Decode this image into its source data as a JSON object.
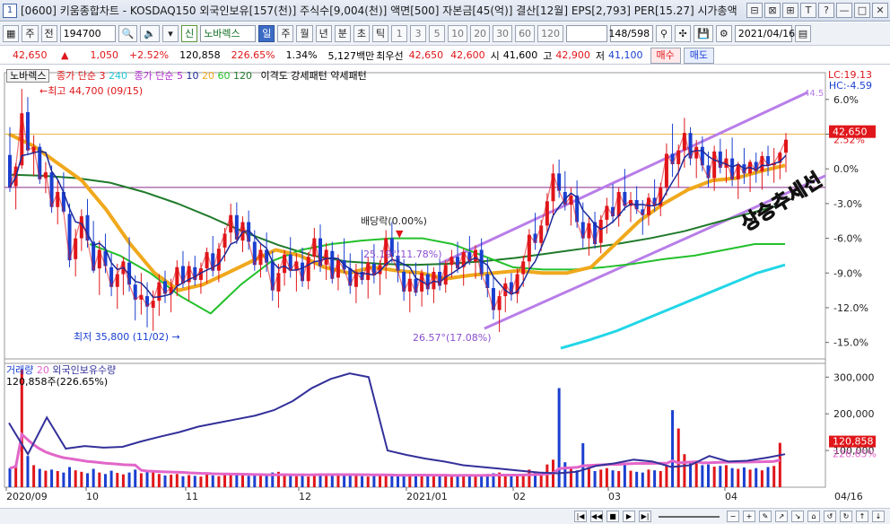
{
  "window": {
    "num": "1",
    "title": "[0600] 키움종합차트 - KOSDAQ150 외국인보유[157(천)] 주식수[9,004(천)] 액면[500] 자본금[45(억)] 결산[12월] EPS[2,793] PER[15.27] 시가총액",
    "buttons": [
      "⊟",
      "⊠",
      "⊞",
      "T",
      "?",
      "—",
      "□",
      "✕"
    ]
  },
  "toolbar": {
    "code_icon": "grid-icon",
    "stock_btn": "주",
    "jeon_btn": "전",
    "code_value": "194700",
    "signal_badge": "신",
    "stock_name": "노바렉스",
    "periods": [
      "일",
      "주",
      "월",
      "년",
      "분",
      "초",
      "틱"
    ],
    "active_period": "일",
    "ticks": [
      "1",
      "3",
      "5",
      "10",
      "20",
      "30",
      "60",
      "120"
    ],
    "count": "148",
    "total": "/598",
    "date": "2021/04/16"
  },
  "price": {
    "current": "42,650",
    "arrow": "▲",
    "change": "1,050",
    "change_pct": "+2.52%",
    "volume": "120,858",
    "vol_ratio": "226.65%",
    "turnover": "1.34%",
    "amount": "5,127백만",
    "best_ask_label": "최우선",
    "best_ask": "42,650",
    "best_bid": "42,600",
    "open_label": "시",
    "open": "41,600",
    "high_label": "고",
    "high": "42,900",
    "low_label": "저",
    "low": "41,100",
    "buy_btn": "매수",
    "sell_btn": "매도"
  },
  "legend": {
    "name": "노바렉스",
    "ma_label": "종가 단순",
    "ma1": "3",
    "ma2": "240",
    "ma_label2": "종가 단순",
    "ma3": "5",
    "ma4": "10",
    "ma5": "20",
    "ma6": "60",
    "ma7": "120",
    "extra": "이격도 강세패턴  약세패턴",
    "lc": "LC:19.13",
    "hc": "HC:-4.59"
  },
  "annotations": {
    "high_marker": "최고 44,700 (09/15)",
    "low_marker": "최저 35,800 (11/02)",
    "dividend": "배당락(0.00%)",
    "angle1": "25.19°(11.78%)",
    "angle2": "26.57°(17.08%)",
    "channel_top": "44.5",
    "trend_text": "상승추세선"
  },
  "yaxis_pct": [
    "6.0%",
    "3.0%",
    "2.52%",
    "0.0%",
    "-3.0%",
    "-6.0%",
    "-9.0%",
    "-12.0%",
    "-15.0%"
  ],
  "price_tag": "42,650",
  "volume_legend": {
    "label": "거래량",
    "ma": "20",
    "foreign": "외국인보유수량",
    "value": "120,858주(226.65%)"
  },
  "vol_axis": [
    "300,000",
    "200,000",
    "100,000"
  ],
  "vol_tag": "120,858",
  "vol_tag2": "226.65%",
  "xaxis": [
    "2020/09",
    "10",
    "11",
    "12",
    "2021/01",
    "02",
    "03",
    "04",
    "04/16"
  ],
  "colors": {
    "up": "#e0161a",
    "down": "#1a3fd0",
    "ma20": "#f0a81c",
    "ma60": "#22c02a",
    "ma120": "#1f7a2a",
    "ma240": "#22d6e6",
    "channel": "#b87ee8",
    "vol_ma": "#e266c9",
    "foreign": "#33309a"
  },
  "chart_data": {
    "type": "candlestick",
    "x_range": [
      "2020/08/31",
      "2021/04/16"
    ],
    "y_pct_range": [
      -16.5,
      8.0
    ],
    "reference_price": 41600,
    "candles_pct": [
      [
        1.2,
        3.6,
        -2.0,
        -1.6
      ],
      [
        -1.5,
        0.5,
        -3.5,
        0.2
      ],
      [
        0.3,
        6.9,
        0.0,
        4.8
      ],
      [
        4.9,
        6.2,
        1.2,
        1.6
      ],
      [
        1.4,
        2.9,
        -0.6,
        1.9
      ],
      [
        1.9,
        2.2,
        -1.3,
        -0.9
      ],
      [
        -0.8,
        0.6,
        -2.1,
        -0.3
      ],
      [
        -0.3,
        0.3,
        -3.8,
        -3.3
      ],
      [
        -3.3,
        -1.0,
        -4.8,
        -2.0
      ],
      [
        -2.0,
        -0.3,
        -3.9,
        -3.7
      ],
      [
        -3.9,
        -3.0,
        -8.5,
        -7.9
      ],
      [
        -7.8,
        -5.2,
        -9.3,
        -6.0
      ],
      [
        -6.0,
        -3.5,
        -7.1,
        -4.1
      ],
      [
        -4.0,
        -2.6,
        -6.8,
        -6.2
      ],
      [
        -6.3,
        -4.5,
        -9.0,
        -8.8
      ],
      [
        -8.6,
        -6.2,
        -10.9,
        -7.0
      ],
      [
        -7.1,
        -5.6,
        -9.0,
        -8.4
      ],
      [
        -8.5,
        -7.3,
        -11.0,
        -10.2
      ],
      [
        -10.2,
        -8.2,
        -12.1,
        -9.1
      ],
      [
        -9.1,
        -7.6,
        -10.9,
        -8.0
      ],
      [
        -8.1,
        -5.9,
        -10.6,
        -10.0
      ],
      [
        -10.0,
        -9.2,
        -13.1,
        -11.3
      ],
      [
        -11.3,
        -9.0,
        -12.6,
        -10.9
      ],
      [
        -11.0,
        -9.8,
        -13.7,
        -11.9
      ],
      [
        -12.0,
        -10.5,
        -14.0,
        -11.4
      ],
      [
        -11.4,
        -9.1,
        -12.7,
        -9.8
      ],
      [
        -9.7,
        -8.8,
        -11.6,
        -10.8
      ],
      [
        -10.8,
        -9.5,
        -12.4,
        -10.2
      ],
      [
        -10.1,
        -7.9,
        -11.0,
        -8.5
      ],
      [
        -8.4,
        -7.1,
        -10.3,
        -9.9
      ],
      [
        -9.8,
        -8.0,
        -11.4,
        -8.4
      ],
      [
        -8.5,
        -7.5,
        -10.1,
        -9.6
      ],
      [
        -9.6,
        -8.1,
        -10.8,
        -8.6
      ],
      [
        -8.6,
        -6.8,
        -9.9,
        -7.2
      ],
      [
        -7.3,
        -5.8,
        -9.3,
        -8.8
      ],
      [
        -8.8,
        -6.4,
        -9.8,
        -6.9
      ],
      [
        -6.8,
        -5.1,
        -8.0,
        -5.6
      ],
      [
        -5.5,
        -3.0,
        -6.4,
        -4.0
      ],
      [
        -4.0,
        -2.9,
        -6.5,
        -6.1
      ],
      [
        -6.2,
        -4.1,
        -7.2,
        -4.6
      ],
      [
        -4.6,
        -3.6,
        -7.0,
        -6.3
      ],
      [
        -6.3,
        -5.3,
        -8.8,
        -8.3
      ],
      [
        -8.3,
        -6.5,
        -9.4,
        -7.0
      ],
      [
        -7.0,
        -5.5,
        -8.9,
        -8.1
      ],
      [
        -8.0,
        -7.1,
        -11.4,
        -10.5
      ],
      [
        -10.6,
        -8.2,
        -12.0,
        -9.0
      ],
      [
        -9.0,
        -7.0,
        -10.1,
        -7.4
      ],
      [
        -7.4,
        -5.9,
        -9.4,
        -8.8
      ],
      [
        -8.8,
        -7.3,
        -10.6,
        -8.0
      ],
      [
        -8.1,
        -6.8,
        -10.2,
        -9.7
      ],
      [
        -9.7,
        -7.2,
        -10.4,
        -7.6
      ],
      [
        -7.6,
        -5.1,
        -8.7,
        -6.0
      ],
      [
        -6.0,
        -4.8,
        -8.9,
        -8.4
      ],
      [
        -8.3,
        -6.4,
        -9.6,
        -7.0
      ],
      [
        -7.1,
        -6.3,
        -9.9,
        -9.5
      ],
      [
        -9.4,
        -7.4,
        -10.5,
        -7.9
      ],
      [
        -7.9,
        -6.0,
        -9.0,
        -8.7
      ],
      [
        -8.6,
        -7.3,
        -10.8,
        -10.1
      ],
      [
        -10.2,
        -8.2,
        -11.6,
        -8.9
      ],
      [
        -8.9,
        -7.0,
        -10.0,
        -9.6
      ],
      [
        -9.6,
        -7.6,
        -11.2,
        -8.1
      ],
      [
        -8.2,
        -6.5,
        -9.9,
        -9.2
      ],
      [
        -9.1,
        -7.9,
        -10.9,
        -8.3
      ],
      [
        -8.4,
        -5.3,
        -9.5,
        -6.0
      ],
      [
        -6.0,
        -4.6,
        -8.1,
        -7.6
      ],
      [
        -7.5,
        -6.3,
        -9.8,
        -8.8
      ],
      [
        -8.9,
        -7.8,
        -11.4,
        -10.6
      ],
      [
        -10.6,
        -8.9,
        -12.4,
        -9.5
      ],
      [
        -9.5,
        -8.1,
        -11.0,
        -10.7
      ],
      [
        -10.6,
        -8.7,
        -11.9,
        -9.0
      ],
      [
        -9.1,
        -8.3,
        -10.9,
        -10.4
      ],
      [
        -10.4,
        -8.5,
        -11.6,
        -8.9
      ],
      [
        -8.9,
        -7.8,
        -10.5,
        -10.1
      ],
      [
        -10.0,
        -7.9,
        -10.7,
        -8.3
      ],
      [
        -8.3,
        -7.0,
        -9.4,
        -7.6
      ],
      [
        -7.6,
        -6.3,
        -9.0,
        -8.6
      ],
      [
        -8.5,
        -6.9,
        -10.1,
        -7.2
      ],
      [
        -7.2,
        -5.8,
        -8.3,
        -8.0
      ],
      [
        -8.0,
        -6.6,
        -9.5,
        -7.0
      ],
      [
        -7.0,
        -6.0,
        -9.6,
        -9.1
      ],
      [
        -9.1,
        -7.7,
        -11.1,
        -10.3
      ],
      [
        -10.3,
        -9.3,
        -13.0,
        -12.2
      ],
      [
        -12.2,
        -10.5,
        -14.1,
        -11.0
      ],
      [
        -11.0,
        -9.4,
        -12.4,
        -9.9
      ],
      [
        -9.8,
        -9.0,
        -11.4,
        -10.8
      ],
      [
        -10.8,
        -8.6,
        -11.6,
        -9.1
      ],
      [
        -9.1,
        -7.5,
        -10.2,
        -8.0
      ],
      [
        -8.0,
        -5.2,
        -8.6,
        -5.7
      ],
      [
        -5.6,
        -3.8,
        -7.0,
        -6.4
      ],
      [
        -6.4,
        -4.4,
        -7.1,
        -4.9
      ],
      [
        -4.9,
        -2.1,
        -5.5,
        -2.8
      ],
      [
        -2.8,
        0.4,
        -4.2,
        -0.4
      ],
      [
        -0.4,
        0.8,
        -2.5,
        -1.9
      ],
      [
        -2.0,
        -0.2,
        -3.6,
        -3.1
      ],
      [
        -3.1,
        -1.6,
        -4.9,
        -2.3
      ],
      [
        -2.3,
        -1.0,
        -5.1,
        -4.6
      ],
      [
        -4.6,
        -2.9,
        -6.8,
        -6.0
      ],
      [
        -6.0,
        -4.1,
        -7.5,
        -4.7
      ],
      [
        -4.6,
        -3.7,
        -6.9,
        -6.5
      ],
      [
        -6.4,
        -4.0,
        -7.3,
        -4.4
      ],
      [
        -4.4,
        -2.5,
        -5.6,
        -3.2
      ],
      [
        -3.3,
        -1.3,
        -4.7,
        -4.1
      ],
      [
        -4.1,
        -1.6,
        -5.0,
        -2.0
      ],
      [
        -2.0,
        0.0,
        -3.6,
        -3.2
      ],
      [
        -3.2,
        -2.0,
        -4.6,
        -2.7
      ],
      [
        -2.7,
        -1.5,
        -3.9,
        -3.5
      ],
      [
        -3.5,
        -2.7,
        -5.7,
        -4.0
      ],
      [
        -4.0,
        -2.1,
        -4.9,
        -2.5
      ],
      [
        -2.5,
        -0.9,
        -3.7,
        -3.2
      ],
      [
        -3.2,
        -1.2,
        -4.1,
        -1.6
      ],
      [
        -1.6,
        2.2,
        -2.3,
        1.3
      ],
      [
        1.3,
        3.9,
        -0.7,
        0.4
      ],
      [
        0.4,
        2.1,
        -1.6,
        1.6
      ],
      [
        1.6,
        4.4,
        0.1,
        3.1
      ],
      [
        3.1,
        3.6,
        0.3,
        0.9
      ],
      [
        0.9,
        2.5,
        -0.8,
        1.9
      ],
      [
        1.9,
        2.8,
        -0.2,
        0.3
      ],
      [
        0.3,
        1.5,
        -1.6,
        -0.8
      ],
      [
        -0.8,
        2.0,
        -1.9,
        1.5
      ],
      [
        1.5,
        2.6,
        -0.4,
        0.1
      ],
      [
        0.1,
        1.7,
        -1.2,
        0.9
      ],
      [
        0.9,
        2.7,
        -1.5,
        -0.9
      ],
      [
        -0.9,
        0.6,
        -2.6,
        0.4
      ],
      [
        0.4,
        1.8,
        -1.3,
        -0.4
      ],
      [
        -0.4,
        0.8,
        -2.0,
        0.6
      ],
      [
        0.6,
        1.4,
        -1.2,
        -0.2
      ],
      [
        -0.2,
        1.5,
        -1.8,
        1.1
      ],
      [
        1.1,
        2.0,
        -0.6,
        0.3
      ],
      [
        0.3,
        1.8,
        -1.2,
        0.5
      ],
      [
        0.5,
        1.5,
        -0.9,
        1.4
      ],
      [
        1.4,
        3.1,
        -0.3,
        2.52
      ]
    ],
    "volume": [
      52000,
      60000,
      320000,
      85000,
      60000,
      50000,
      45000,
      48000,
      44000,
      40000,
      55000,
      46000,
      42000,
      38000,
      50000,
      40000,
      36000,
      45000,
      39000,
      35000,
      40000,
      48000,
      38000,
      42000,
      44000,
      36000,
      32000,
      34000,
      36000,
      30000,
      33000,
      31000,
      29000,
      35000,
      32000,
      30000,
      34000,
      38000,
      36000,
      33000,
      31000,
      35000,
      37000,
      32000,
      40000,
      42000,
      34000,
      33000,
      30000,
      31000,
      29000,
      35000,
      38000,
      33000,
      36000,
      32000,
      31000,
      34000,
      36000,
      30000,
      29000,
      32000,
      33000,
      34000,
      35000,
      31000,
      30000,
      36000,
      32000,
      33000,
      31000,
      30000,
      34000,
      32000,
      29000,
      31000,
      33000,
      35000,
      30000,
      32000,
      36000,
      38000,
      40000,
      34000,
      32000,
      33000,
      36000,
      48000,
      42000,
      40000,
      62000,
      75000,
      270000,
      68000,
      50000,
      46000,
      120000,
      55000,
      44000,
      48000,
      52000,
      46000,
      44000,
      60000,
      45000,
      42000,
      40000,
      48000,
      46000,
      44000,
      58000,
      210000,
      160000,
      90000,
      70000,
      65000,
      60000,
      62000,
      56000,
      58000,
      60000,
      52000,
      50000,
      54000,
      48000,
      52000,
      46000,
      55000,
      58000,
      120858
    ],
    "ma_series": {
      "ma20_pct": [
        3.0,
        2.0,
        0.5,
        -1.0,
        -3.5,
        -6.5,
        -9.0,
        -10.5,
        -10.0,
        -9.0,
        -8.0,
        -7.0,
        -7.5,
        -8.5,
        -9.0,
        -8.5,
        -8.8,
        -9.0,
        -9.5,
        -9.2,
        -9.0,
        -8.8,
        -9.0,
        -9.0,
        -8.5,
        -6.5,
        -4.5,
        -3.0,
        -1.8,
        -1.0,
        -0.8,
        -0.2,
        0.3
      ],
      "ma60_pct": [
        -6.5,
        -7.5,
        -9.0,
        -11.0,
        -12.5,
        -10.0,
        -8.0,
        -7.0,
        -6.5,
        -6.2,
        -6.0,
        -6.0,
        -6.5,
        -7.5,
        -8.5,
        -8.7,
        -8.7,
        -8.5,
        -8.2,
        -7.8,
        -7.5,
        -7.0,
        -6.5,
        -6.5
      ],
      "ma120_pct": [
        -0.5,
        -0.6,
        -0.8,
        -1.2,
        -2.0,
        -3.0,
        -4.2,
        -5.5,
        -6.6,
        -7.5,
        -8.0,
        -8.2,
        -8.3,
        -8.2,
        -8.0,
        -7.7,
        -7.3,
        -6.9,
        -6.5,
        -6.0,
        -5.4,
        -4.6,
        -3.8,
        -3.0
      ],
      "ma240_pct": [
        -15.5,
        -14.8,
        -14.0,
        -13.0,
        -12.0,
        -11.0,
        -10.0,
        -9.0,
        -8.3
      ]
    },
    "foreign_holding": [
      175000,
      90000,
      190000,
      105000,
      112000,
      108000,
      110000,
      125000,
      138000,
      150000,
      165000,
      175000,
      185000,
      195000,
      210000,
      235000,
      270000,
      295000,
      310000,
      300000,
      100000,
      88000,
      78000,
      70000,
      60000,
      55000,
      50000,
      45000,
      40000,
      38000,
      42000,
      58000,
      65000,
      75000,
      70000,
      55000,
      60000,
      85000,
      70000,
      72000,
      80000,
      90000
    ]
  }
}
